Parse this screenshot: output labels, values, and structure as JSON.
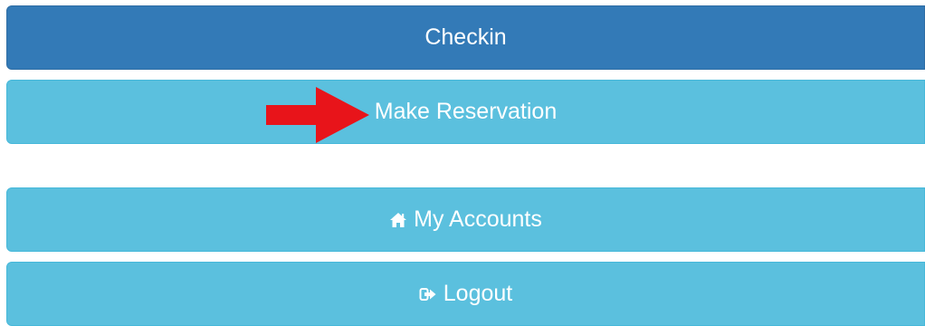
{
  "buttons": {
    "checkin": {
      "label": "Checkin"
    },
    "make_reservation": {
      "label": "Make Reservation"
    },
    "my_accounts": {
      "label": "My Accounts",
      "icon": "home-icon"
    },
    "logout": {
      "label": "Logout",
      "icon": "sign-out-icon"
    }
  },
  "annotation": {
    "icon": "red-arrow-icon",
    "color": "#e8141a"
  },
  "colors": {
    "primary": "#337ab7",
    "info": "#5bc0de",
    "text": "#ffffff"
  }
}
